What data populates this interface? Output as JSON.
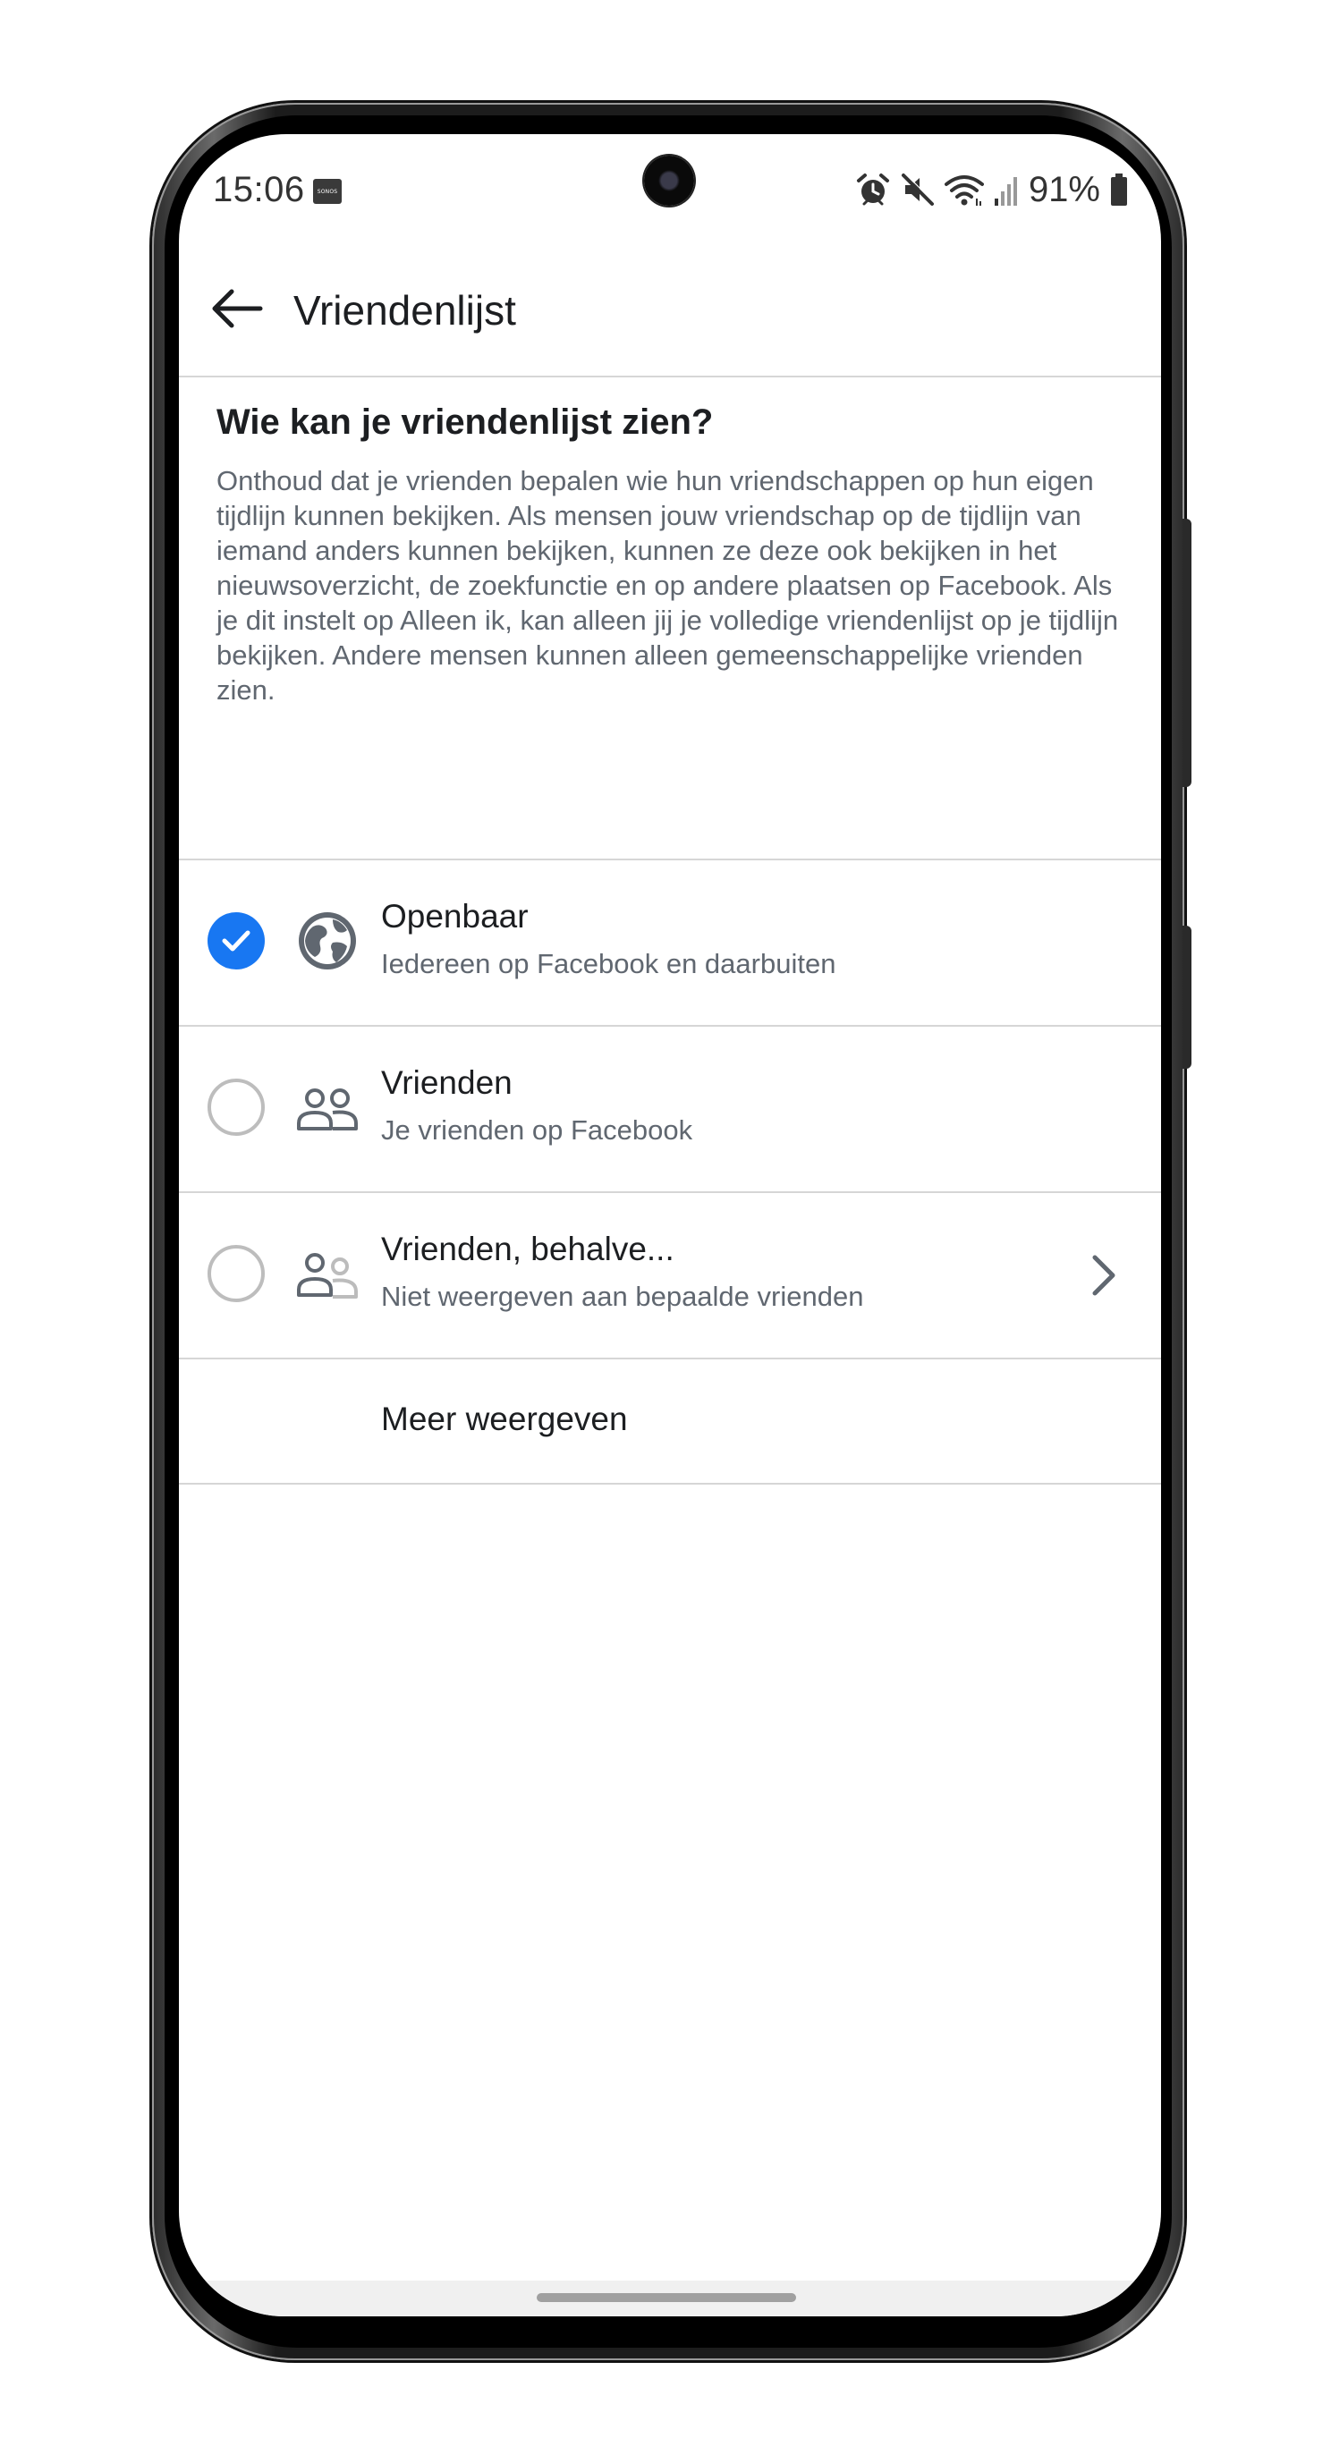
{
  "status_bar": {
    "time": "15:06",
    "sonos_label": "SONOS",
    "battery": "91%",
    "icons": [
      "alarm-icon",
      "mute-icon",
      "wifi-icon",
      "signal-icon",
      "battery-icon"
    ]
  },
  "header": {
    "title": "Vriendenlijst",
    "back_icon": "arrow-left-icon"
  },
  "intro": {
    "heading": "Wie kan je vriendenlijst zien?",
    "body": "Onthoud dat je vrienden bepalen wie hun vriendschappen op hun eigen tijdlijn kunnen bekijken. Als mensen jouw vriendschap op de tijdlijn van iemand anders kunnen bekijken, kunnen ze deze ook bekijken in het nieuwsoverzicht, de zoekfunctie en op andere plaatsen op Facebook. Als je dit instelt op Alleen ik, kan alleen jij je volledige vriendenlijst op je tijdlijn bekijken. Andere mensen kunnen alleen gemeenschappelijke vrienden zien."
  },
  "options": [
    {
      "title": "Openbaar",
      "subtitle": "Iedereen op Facebook en daarbuiten",
      "selected": true,
      "icon": "globe-icon"
    },
    {
      "title": "Vrienden",
      "subtitle": "Je vrienden op Facebook",
      "selected": false,
      "icon": "friends-icon"
    },
    {
      "title": "Vrienden, behalve...",
      "subtitle": "Niet weergeven aan bepaalde vrienden",
      "selected": false,
      "icon": "friends-except-icon",
      "has_chevron": true
    }
  ],
  "more": {
    "label": "Meer weergeven"
  },
  "colors": {
    "accent": "#1877f2",
    "text_primary": "#1c1e21",
    "text_secondary": "#606770",
    "divider": "#d6d6d6"
  }
}
